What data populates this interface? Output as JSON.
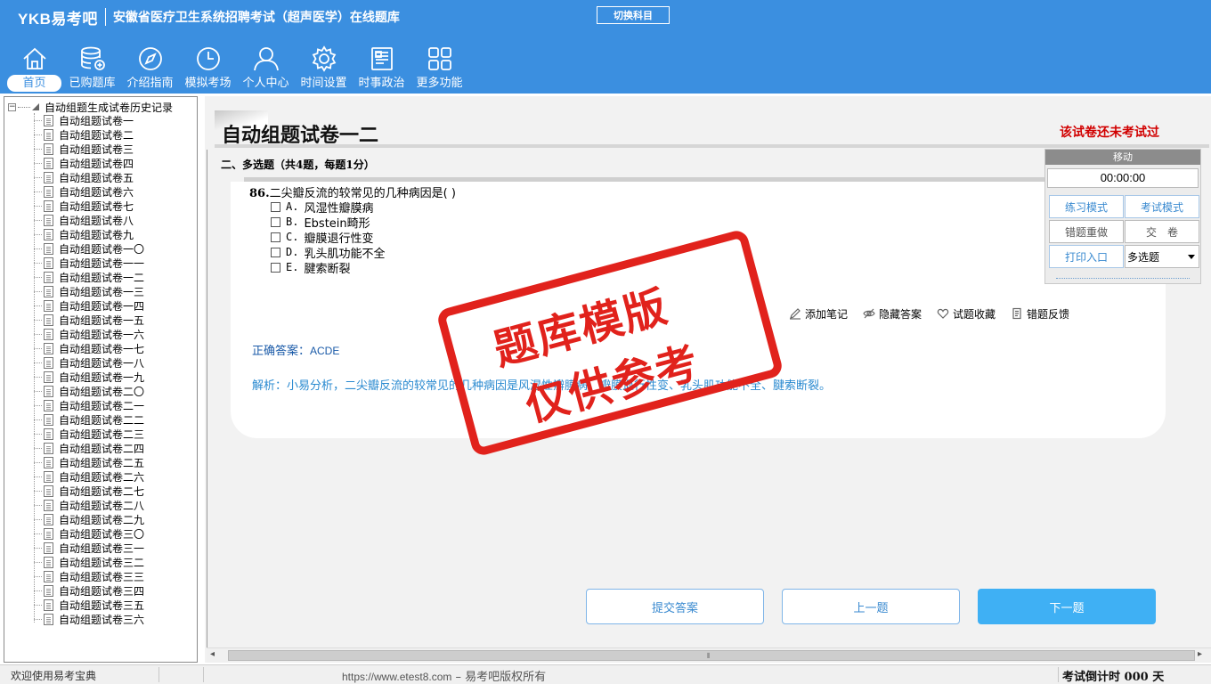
{
  "header": {
    "logo": "YKB易考吧",
    "title": "安徽省医疗卫生系统招聘考试（超声医学）在线题库",
    "switch_label": "切换科目",
    "colors": {
      "header_bg": "#3b8fe0",
      "accent_red": "#d10000",
      "primary_button": "#3fb0f4"
    }
  },
  "nav": [
    {
      "label": "首页",
      "icon": "home-icon"
    },
    {
      "label": "已购题库",
      "icon": "database-icon"
    },
    {
      "label": "介绍指南",
      "icon": "compass-icon"
    },
    {
      "label": "模拟考场",
      "icon": "clock-icon"
    },
    {
      "label": "个人中心",
      "icon": "user-icon"
    },
    {
      "label": "时间设置",
      "icon": "gear-icon"
    },
    {
      "label": "时事政治",
      "icon": "newspaper-icon"
    },
    {
      "label": "更多功能",
      "icon": "grid-icon"
    }
  ],
  "sidebar": {
    "root": "自动组题生成试卷历史记录",
    "items": [
      "自动组题试卷一",
      "自动组题试卷二",
      "自动组题试卷三",
      "自动组题试卷四",
      "自动组题试卷五",
      "自动组题试卷六",
      "自动组题试卷七",
      "自动组题试卷八",
      "自动组题试卷九",
      "自动组题试卷一〇",
      "自动组题试卷一一",
      "自动组题试卷一二",
      "自动组题试卷一三",
      "自动组题试卷一四",
      "自动组题试卷一五",
      "自动组题试卷一六",
      "自动组题试卷一七",
      "自动组题试卷一八",
      "自动组题试卷一九",
      "自动组题试卷二〇",
      "自动组题试卷二一",
      "自动组题试卷二二",
      "自动组题试卷二三",
      "自动组题试卷二四",
      "自动组题试卷二五",
      "自动组题试卷二六",
      "自动组题试卷二七",
      "自动组题试卷二八",
      "自动组题试卷二九",
      "自动组题试卷三〇",
      "自动组题试卷三一",
      "自动组题试卷三二",
      "自动组题试卷三三",
      "自动组题试卷三四",
      "自动组题试卷三五",
      "自动组题试卷三六"
    ]
  },
  "paper": {
    "title": "自动组题试卷一二",
    "status": "该试卷还未考试过"
  },
  "section": {
    "heading": "二、多选题（共4题，每题1分）"
  },
  "question": {
    "number": "86.",
    "stem": "二尖瓣反流的较常见的几种病因是( )",
    "options": [
      {
        "key": "A.",
        "text": "风湿性瓣膜病"
      },
      {
        "key": "B.",
        "text": "Ebstein畸形"
      },
      {
        "key": "C.",
        "text": "瓣膜退行性变"
      },
      {
        "key": "D.",
        "text": "乳头肌功能不全"
      },
      {
        "key": "E.",
        "text": "腱索断裂"
      }
    ],
    "tools": {
      "add_note": "添加笔记",
      "hide_answer": "隐藏答案",
      "favorite": "试题收藏",
      "report_error": "错题反馈"
    },
    "answer_label": "正确答案：",
    "answer_value": "ACDE",
    "analysis": "解析：小易分析，二尖瓣反流的较常见的几种病因是风湿性瓣膜病、瓣膜退行性变、乳头肌功能不全、腱索断裂。"
  },
  "stamp": {
    "line1": "题库模版",
    "line2": "仅供参考"
  },
  "control": {
    "move": "移动",
    "timer": "00:00:00",
    "practice_mode": "练习模式",
    "exam_mode": "考试模式",
    "redo_wrong": "错题重做",
    "submit_paper": "交　卷",
    "print_entry": "打印入口",
    "question_type": "多选题"
  },
  "buttons": {
    "submit_answer": "提交答案",
    "prev": "上一题",
    "next": "下一题"
  },
  "status": {
    "welcome": "欢迎使用易考宝典",
    "url": "https://www.etest8.com",
    "copyright": " – 易考吧版权所有",
    "countdown": "考试倒计时 000 天"
  }
}
